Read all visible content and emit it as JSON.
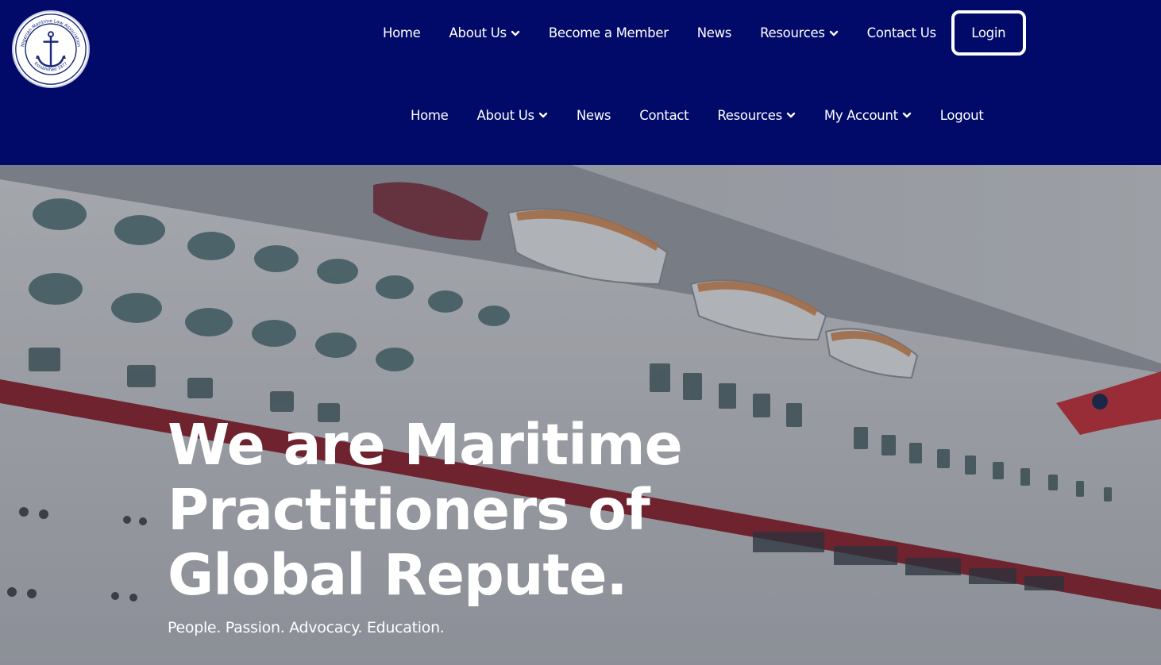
{
  "logo": {
    "name": "Nigerian Maritime Law Association",
    "established": "Established 1977",
    "icon": "anchor-icon"
  },
  "nav_primary": {
    "items": [
      {
        "label": "Home",
        "dropdown": false
      },
      {
        "label": "About Us",
        "dropdown": true
      },
      {
        "label": "Become a Member",
        "dropdown": false
      },
      {
        "label": "News",
        "dropdown": false
      },
      {
        "label": "Resources",
        "dropdown": true
      },
      {
        "label": "Contact Us",
        "dropdown": false
      }
    ],
    "login_label": "Login"
  },
  "nav_secondary": {
    "items": [
      {
        "label": "Home",
        "dropdown": false
      },
      {
        "label": "About Us",
        "dropdown": true
      },
      {
        "label": "News",
        "dropdown": false
      },
      {
        "label": "Contact",
        "dropdown": false
      },
      {
        "label": "Resources",
        "dropdown": true
      },
      {
        "label": "My Account",
        "dropdown": true
      },
      {
        "label": "Logout",
        "dropdown": false
      }
    ]
  },
  "hero": {
    "title": "We are Maritime Practitioners of Global Repute.",
    "tagline": "People. Passion. Advocacy. Education."
  },
  "colors": {
    "header_bg": "#010a69",
    "text": "#ffffff"
  }
}
